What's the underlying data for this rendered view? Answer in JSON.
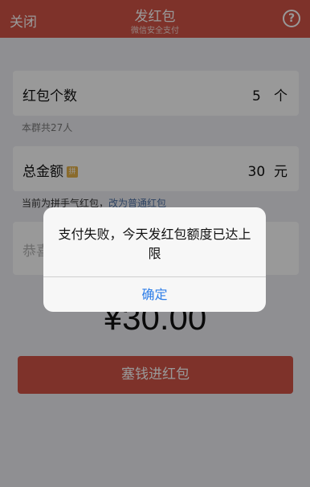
{
  "header": {
    "close_label": "关闭",
    "title": "发红包",
    "subtitle": "微信安全支付",
    "help_label": "?"
  },
  "count_card": {
    "label": "红包个数",
    "value": "5",
    "unit": "个"
  },
  "group_hint": "本群共27人",
  "amount_card": {
    "label": "总金额",
    "badge": "拼",
    "value": "30",
    "unit": "元"
  },
  "mode_hint": {
    "text": "当前为拼手气红包，",
    "link": "改为普通红包"
  },
  "greeting_placeholder": "恭喜",
  "amount_display": "¥30.00",
  "submit_label": "塞钱进红包",
  "dialog": {
    "message": "支付失败，今天发红包额度已达上限",
    "confirm_label": "确定"
  },
  "colors": {
    "brand_red": "#d35446",
    "link_blue": "#2e7ee8"
  }
}
